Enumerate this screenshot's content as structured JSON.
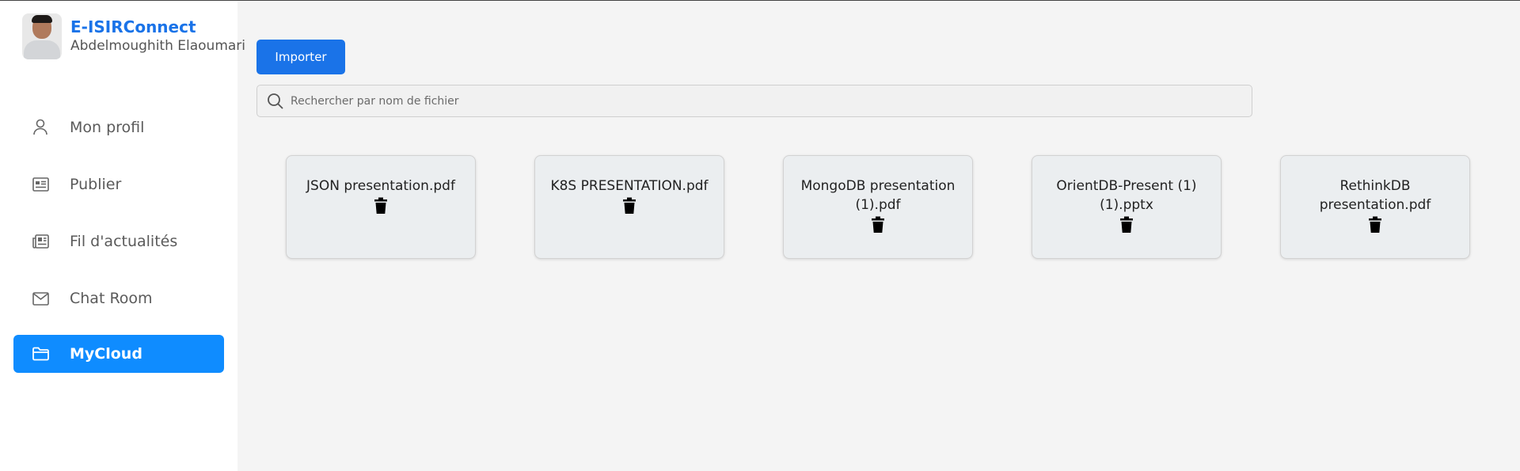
{
  "app": {
    "name": "E-ISIRConnect",
    "user_name": "Abdelmoughith Elaoumari"
  },
  "sidebar": {
    "items": [
      {
        "label": "Mon profil",
        "icon": "user-icon",
        "active": false
      },
      {
        "label": "Publier",
        "icon": "newspaper-icon",
        "active": false
      },
      {
        "label": "Fil d'actualités",
        "icon": "feed-icon",
        "active": false
      },
      {
        "label": "Chat Room",
        "icon": "mail-icon",
        "active": false
      },
      {
        "label": "MyCloud",
        "icon": "folder-icon",
        "active": true
      }
    ]
  },
  "main": {
    "import_label": "Importer",
    "search_placeholder": "Rechercher par nom de fichier",
    "files": [
      {
        "name": "JSON presentation.pdf"
      },
      {
        "name": "K8S PRESENTATION.pdf"
      },
      {
        "name": "MongoDB presentation (1).pdf"
      },
      {
        "name": "OrientDB-Present (1) (1).pptx"
      },
      {
        "name": "RethinkDB presentation.pdf"
      }
    ]
  },
  "colors": {
    "accent": "#1a73e8",
    "active_nav": "#0f8cff",
    "page_background": "#f4f4f4",
    "card_background": "#ebeef0"
  }
}
